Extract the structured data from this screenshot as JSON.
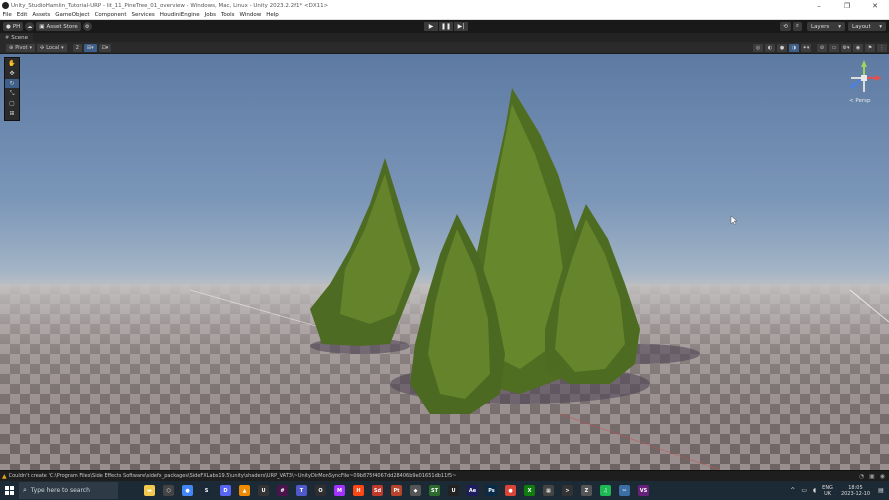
{
  "window": {
    "title": "Unity_StudioHamlin_Tutorial-URP - lit_11_PineTree_01_overview - Windows, Mac, Linux - Unity 2023.2.2f1* <DX11>",
    "controls": [
      "–",
      "❐",
      "✕"
    ]
  },
  "menu": [
    "File",
    "Edit",
    "Assets",
    "GameObject",
    "Component",
    "Services",
    "HoudiniEngine",
    "Jobs",
    "Tools",
    "Window",
    "Help"
  ],
  "toolbar": {
    "account": "PH",
    "asset_store": "Asset Store",
    "play_controls": [
      "▶",
      "❚❚",
      "▶|"
    ],
    "layers": "Layers",
    "layout": "Layout"
  },
  "scene": {
    "tab_label": "Scene",
    "pivot": "Pivot",
    "local": "Local",
    "grid_value": "2",
    "persp_label": "< Persp"
  },
  "tools": [
    "hand-tool",
    "move-tool",
    "rotate-tool",
    "scale-tool",
    "rect-tool",
    "transform-tool"
  ],
  "console": {
    "message": "Couldn't create 'C:\\Program Files\\Side Effects Software\\sidefx_packages\\SideFXLabs19.5\\unity\\shaders\\URP_VAT3\\~UnityDirMonSyncFile~09b875f4067dd28406b9e01651db11f5~"
  },
  "taskbar": {
    "search_placeholder": "Type here to search",
    "lang_top": "ENG",
    "lang_bottom": "UK",
    "time": "18:05",
    "date": "2023-12-10",
    "apps": [
      {
        "name": "file-explorer-icon",
        "color": "#f2c94c",
        "glyph": "▬"
      },
      {
        "name": "unity-hub-icon",
        "color": "#444",
        "glyph": "⬡"
      },
      {
        "name": "chrome-icon",
        "color": "#4285f4",
        "glyph": "●"
      },
      {
        "name": "steam-icon",
        "color": "#1b2838",
        "glyph": "S"
      },
      {
        "name": "discord-icon",
        "color": "#5865f2",
        "glyph": "D"
      },
      {
        "name": "vlc-icon",
        "color": "#f08a00",
        "glyph": "▲"
      },
      {
        "name": "unity-icon",
        "color": "#333",
        "glyph": "U"
      },
      {
        "name": "slack-icon",
        "color": "#4a154b",
        "glyph": "#"
      },
      {
        "name": "teams-icon",
        "color": "#5059c9",
        "glyph": "T"
      },
      {
        "name": "obs-icon",
        "color": "#302e31",
        "glyph": "O"
      },
      {
        "name": "messenger-icon",
        "color": "#a033ff",
        "glyph": "M"
      },
      {
        "name": "houdini-icon",
        "color": "#ff4713",
        "glyph": "H"
      },
      {
        "name": "substance-designer-icon",
        "color": "#c0392b",
        "glyph": "Sd"
      },
      {
        "name": "substance-painter-icon",
        "color": "#b8442c",
        "glyph": "Pt"
      },
      {
        "name": "unity-editor-icon",
        "color": "#555",
        "glyph": "◆"
      },
      {
        "name": "speedtree-icon",
        "color": "#2d6a2d",
        "glyph": "ST"
      },
      {
        "name": "unreal-icon",
        "color": "#222",
        "glyph": "U"
      },
      {
        "name": "after-effects-icon",
        "color": "#1c1c5e",
        "glyph": "Ae"
      },
      {
        "name": "photoshop-icon",
        "color": "#0a2a4a",
        "glyph": "Ps"
      },
      {
        "name": "chrome-alt-icon",
        "color": "#db4437",
        "glyph": "●"
      },
      {
        "name": "xbox-icon",
        "color": "#107c10",
        "glyph": "X"
      },
      {
        "name": "calculator-icon",
        "color": "#444",
        "glyph": "▦"
      },
      {
        "name": "terminal-icon",
        "color": "#333",
        "glyph": ">"
      },
      {
        "name": "zbrush-icon",
        "color": "#555",
        "glyph": "Z"
      },
      {
        "name": "spotify-icon",
        "color": "#1db954",
        "glyph": "♫"
      },
      {
        "name": "snipping-icon",
        "color": "#3b6ea5",
        "glyph": "✂"
      },
      {
        "name": "visual-studio-icon",
        "color": "#68217a",
        "glyph": "VS"
      }
    ]
  }
}
